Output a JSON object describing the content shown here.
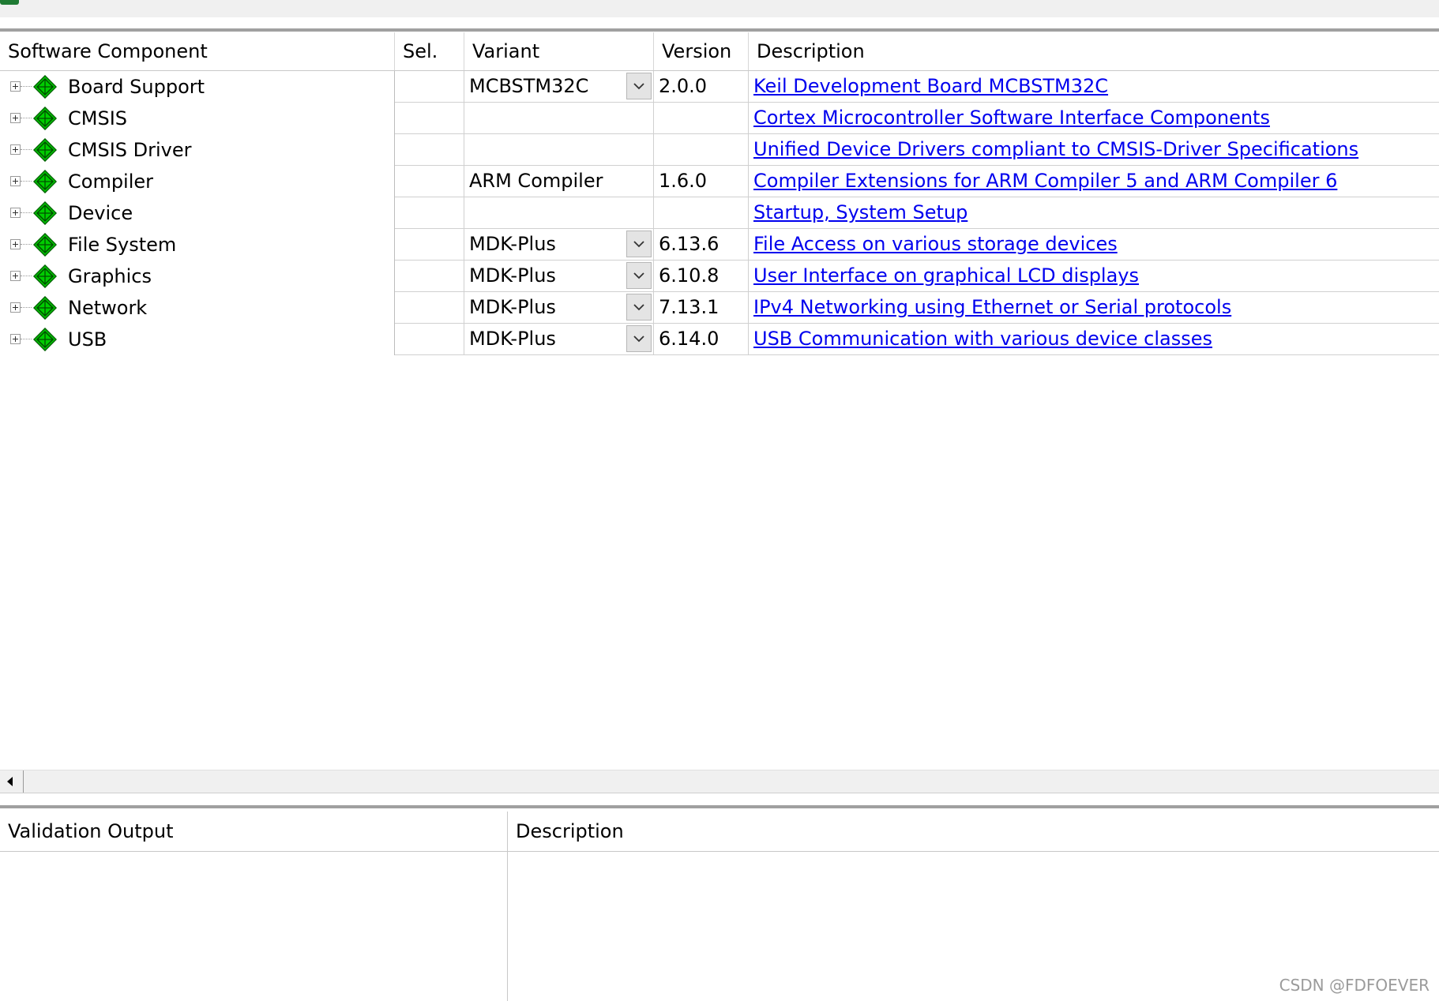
{
  "grid": {
    "columns": {
      "component": "Software Component",
      "sel": "Sel.",
      "variant": "Variant",
      "version": "Version",
      "description": "Description"
    },
    "rows": [
      {
        "name": "Board Support",
        "variant": "MCBSTM32C",
        "has_dropdown": true,
        "version": "2.0.0",
        "description": "Keil Development Board MCBSTM32C"
      },
      {
        "name": "CMSIS",
        "variant": "",
        "has_dropdown": false,
        "version": "",
        "description": "Cortex Microcontroller Software Interface Components"
      },
      {
        "name": "CMSIS Driver",
        "variant": "",
        "has_dropdown": false,
        "version": "",
        "description": "Unified Device Drivers compliant to CMSIS-Driver Specifications"
      },
      {
        "name": "Compiler",
        "variant": "ARM Compiler",
        "has_dropdown": false,
        "version": "1.6.0",
        "description": "Compiler Extensions for ARM Compiler 5 and ARM Compiler 6"
      },
      {
        "name": "Device",
        "variant": "",
        "has_dropdown": false,
        "version": "",
        "description": "Startup, System Setup"
      },
      {
        "name": "File System",
        "variant": "MDK-Plus",
        "has_dropdown": true,
        "version": "6.13.6",
        "description": "File Access on various storage devices"
      },
      {
        "name": "Graphics",
        "variant": "MDK-Plus",
        "has_dropdown": true,
        "version": "6.10.8",
        "description": "User Interface on graphical LCD displays"
      },
      {
        "name": "Network",
        "variant": "MDK-Plus",
        "has_dropdown": true,
        "version": "7.13.1",
        "description": "IPv4 Networking using Ethernet or Serial protocols"
      },
      {
        "name": "USB",
        "variant": "MDK-Plus",
        "has_dropdown": true,
        "version": "6.14.0",
        "description": "USB Communication with various device classes"
      }
    ]
  },
  "validation": {
    "output_header": "Validation Output",
    "description_header": "Description"
  },
  "icons": {
    "component": "green-diamond-component-icon",
    "expand": "plus-expander-icon",
    "dropdown": "chevron-down-icon",
    "scroll_left": "scroll-left-arrow-icon"
  },
  "colors": {
    "component_icon": "#00cc00",
    "link": "#0000ee"
  },
  "watermark": "CSDN @FDFOEVER"
}
